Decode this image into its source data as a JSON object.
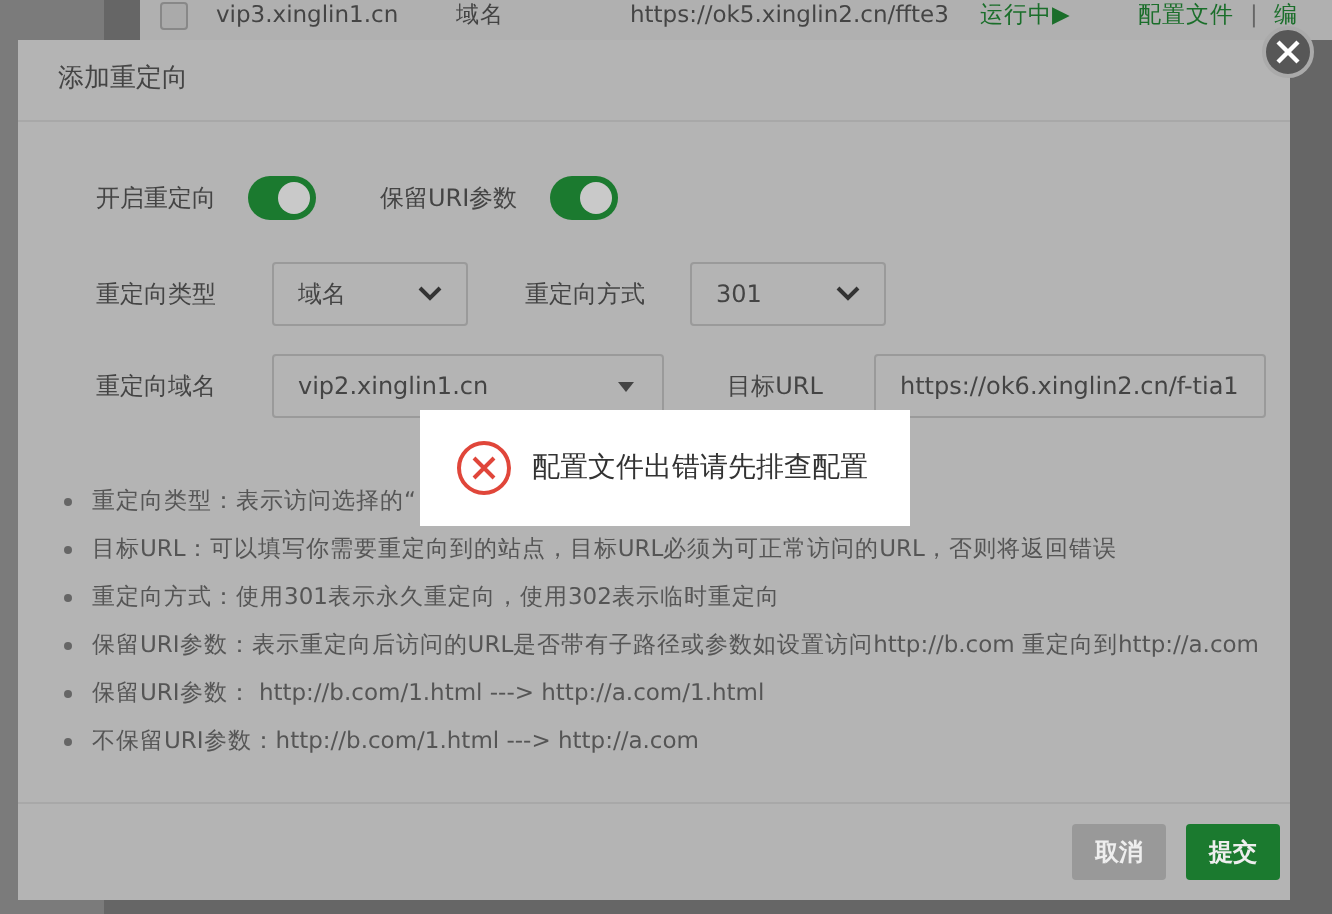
{
  "background_row": {
    "checked": false,
    "domain": "vip3.xinglin1.cn",
    "type": "域名",
    "target": "https://ok5.xinglin2.cn/ffte3",
    "status": "运行中▶",
    "actions": [
      {
        "kind": "link",
        "label": "配置文件"
      },
      {
        "kind": "separator",
        "label": "|"
      },
      {
        "kind": "link",
        "label": "编"
      }
    ]
  },
  "dialog": {
    "title": "添加重定向",
    "toggles": [
      {
        "label": "开启重定向",
        "on": true
      },
      {
        "label": "保留URI参数",
        "on": true
      }
    ],
    "field_rows": [
      [
        {
          "kind": "select",
          "label": "重定向类型",
          "value": "域名"
        },
        {
          "kind": "select",
          "label": "重定向方式",
          "value": "301"
        }
      ],
      [
        {
          "kind": "combo",
          "label": "重定向域名",
          "value": "vip2.xinglin1.cn"
        },
        {
          "kind": "input",
          "label": "目标URL",
          "value": "https://ok6.xinglin2.cn/f-tia1"
        }
      ]
    ],
    "notes": [
      "重定向类型：表示访问选择的“",
      "目标URL：可以填写你需要重定向到的站点，目标URL必须为可正常访问的URL，否则将返回错误",
      "重定向方式：使用301表示永久重定向，使用302表示临时重定向",
      "保留URI参数：表示重定向后访问的URL是否带有子路径或参数如设置访问http://b.com 重定向到http://a.com",
      "保留URI参数：  http://b.com/1.html ---> http://a.com/1.html",
      "不保留URI参数：http://b.com/1.html ---> http://a.com"
    ],
    "buttons": [
      {
        "label": "取消",
        "kind": "cancel"
      },
      {
        "label": "提交",
        "kind": "primary"
      }
    ]
  },
  "toast": {
    "message": "配置文件出错请先排查配置"
  }
}
